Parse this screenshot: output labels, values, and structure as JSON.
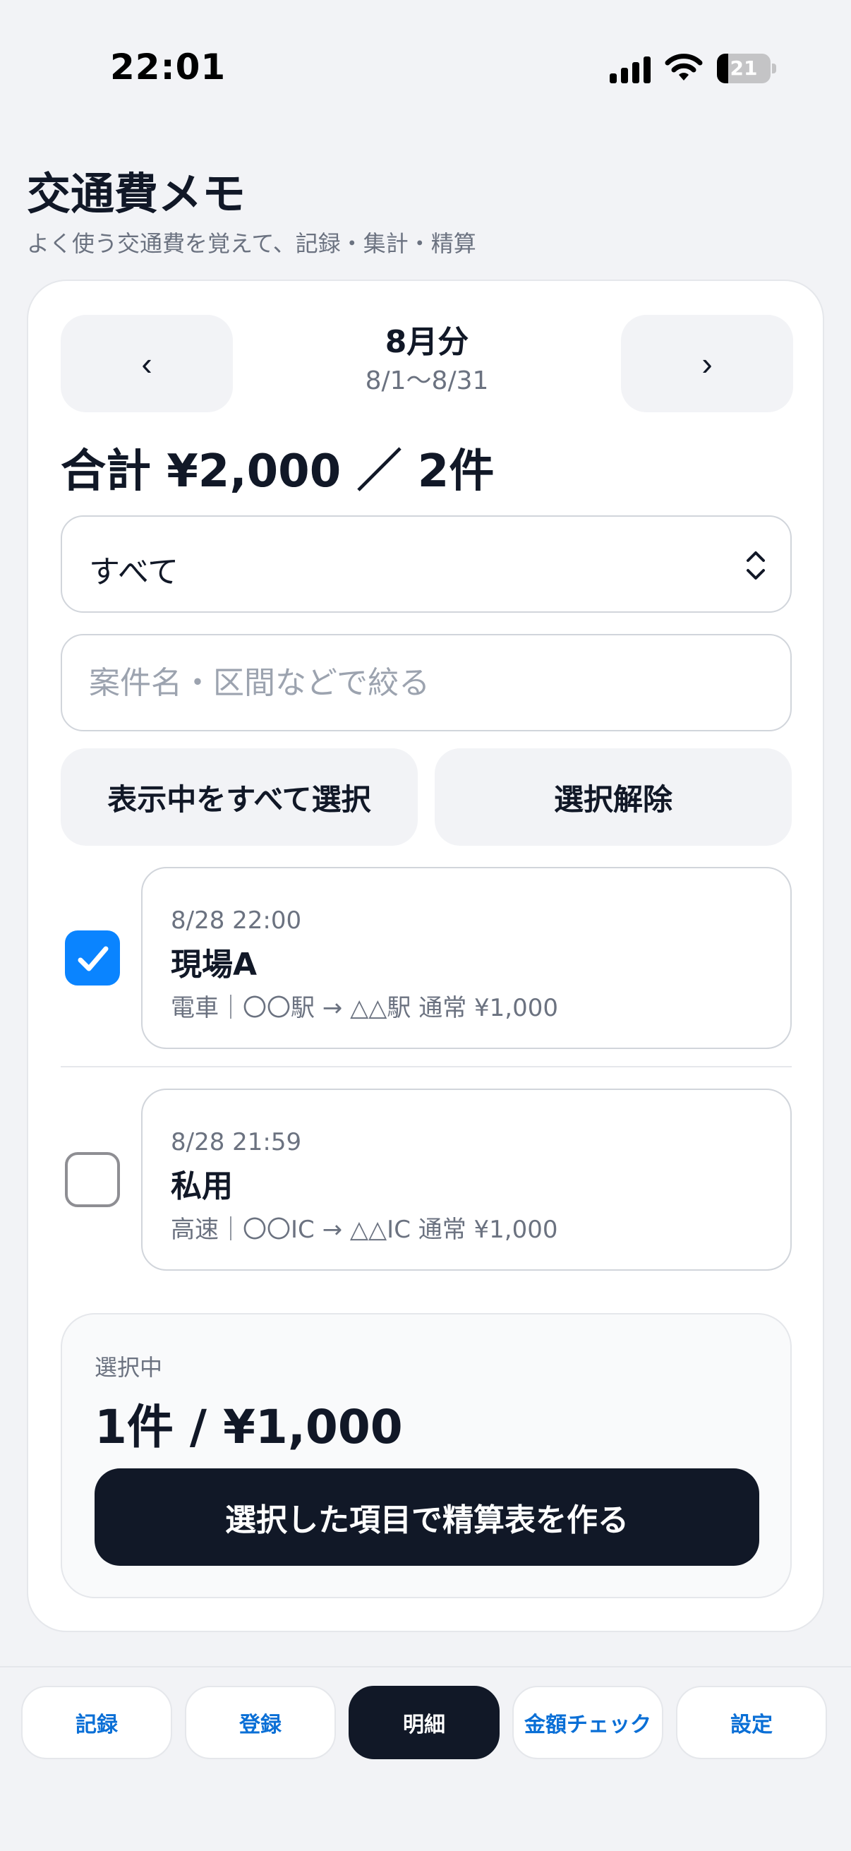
{
  "status": {
    "time": "22:01",
    "battery": 21
  },
  "header": {
    "title": "交通費メモ",
    "subtitle": "よく使う交通費を覚えて、記録・集計・精算"
  },
  "month_nav": {
    "prev_label": "‹",
    "next_label": "›",
    "month": "8月分",
    "range": "8/1〜8/31"
  },
  "total": "合計 ¥2,000 ／ 2件",
  "filter": {
    "selected": "すべて",
    "search_placeholder": "案件名・区間などで絞る"
  },
  "actions": {
    "select_all": "表示中をすべて選択",
    "clear": "選択解除"
  },
  "entries": [
    {
      "checked": true,
      "datetime": "8/28 22:00",
      "title": "現場A",
      "detail": "電車｜〇〇駅 → △△駅 通常 ¥1,000"
    },
    {
      "checked": false,
      "datetime": "8/28 21:59",
      "title": "私用",
      "detail": "高速｜〇〇IC → △△IC 通常 ¥1,000"
    }
  ],
  "summary": {
    "label": "選択中",
    "value": "1件 / ¥1,000",
    "button": "選択した項目で精算表を作る"
  },
  "tabs": [
    {
      "label": "記録",
      "active": false
    },
    {
      "label": "登録",
      "active": false
    },
    {
      "label": "明細",
      "active": true
    },
    {
      "label": "金額チェック",
      "active": false
    },
    {
      "label": "設定",
      "active": false
    }
  ],
  "colors": {
    "accent": "#0a84ff",
    "dark": "#111827",
    "tab_text": "#0a6fd6"
  }
}
